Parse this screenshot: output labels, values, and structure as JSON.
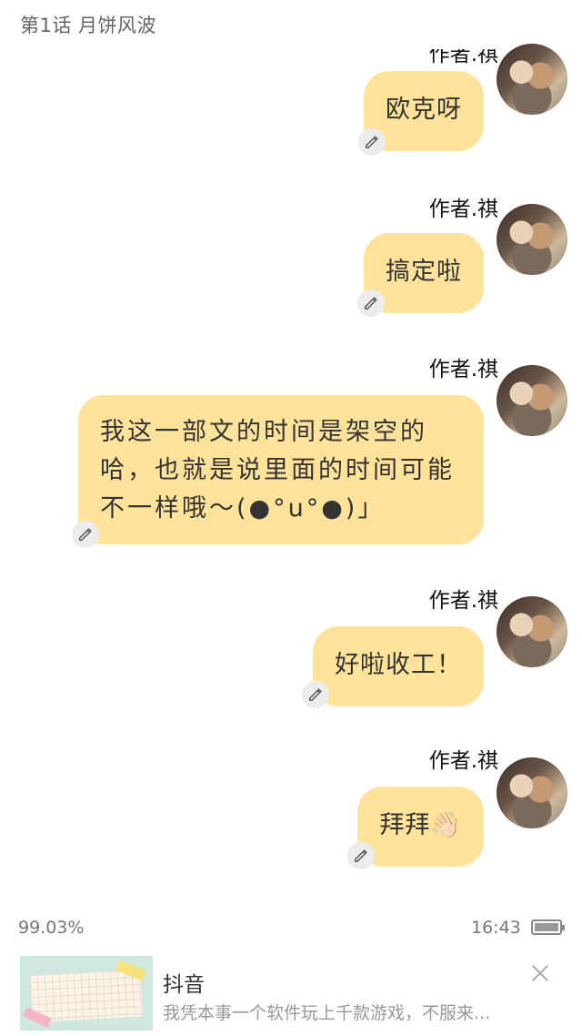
{
  "chapter_title": "第1话 月饼风波",
  "messages": [
    {
      "author": "作者.祺",
      "text_lines": [
        "欧克呀"
      ]
    },
    {
      "author": "作者.祺",
      "text_lines": [
        "搞定啦"
      ]
    },
    {
      "author": "作者.祺",
      "text_lines": [
        "我这一部文的时间是架空的",
        "哈，也就是说里面的时间可能",
        "不一样哦～(●°u°●)」"
      ]
    },
    {
      "author": "作者.祺",
      "text_lines": [
        "好啦收工！"
      ]
    },
    {
      "author": "作者.祺",
      "text_lines": [
        "拜拜👋🏻"
      ]
    }
  ],
  "status": {
    "progress": "99.03%",
    "progress_value": 0.9903,
    "time": "16:43"
  },
  "ad": {
    "title": "抖音",
    "description": "我凭本事一个软件玩上千款游戏，不服来..."
  },
  "icons": {
    "edit": "pencil-edit-icon",
    "close": "close-icon",
    "battery": "battery-icon"
  },
  "colors": {
    "bubble": "#ffe39a",
    "edit_badge": "#ececec"
  }
}
